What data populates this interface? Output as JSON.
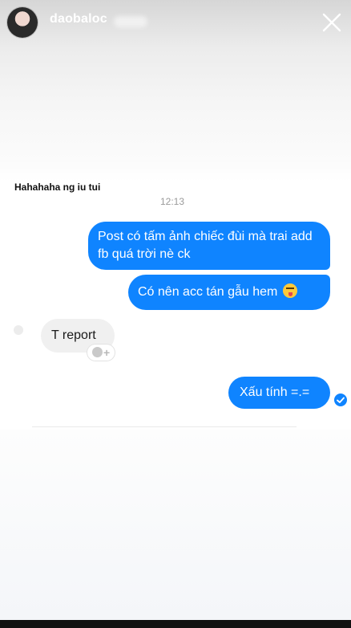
{
  "header": {
    "username": "daobaloc",
    "close_icon": "close-icon"
  },
  "caption": "Hahahaha ng iu tui",
  "chat": {
    "timestamp": "12:13",
    "messages": [
      {
        "direction": "outgoing",
        "text": "Post có tấm ảnh chiếc đùi mà trai add fb quá trời nè ck"
      },
      {
        "direction": "outgoing",
        "text": "Có nên acc tán gẫu hem",
        "emoji": "winking-tongue-emoji"
      },
      {
        "direction": "incoming",
        "text": "T report"
      },
      {
        "direction": "outgoing",
        "text": "Xấu tính =.="
      }
    ],
    "reaction_icon": "add-reaction-icon",
    "seen_icon": "seen-check-icon"
  },
  "colors": {
    "outgoing_bubble": "#0f84ff",
    "incoming_bubble": "#f0f0f0",
    "timestamp": "#9a9a9a"
  }
}
